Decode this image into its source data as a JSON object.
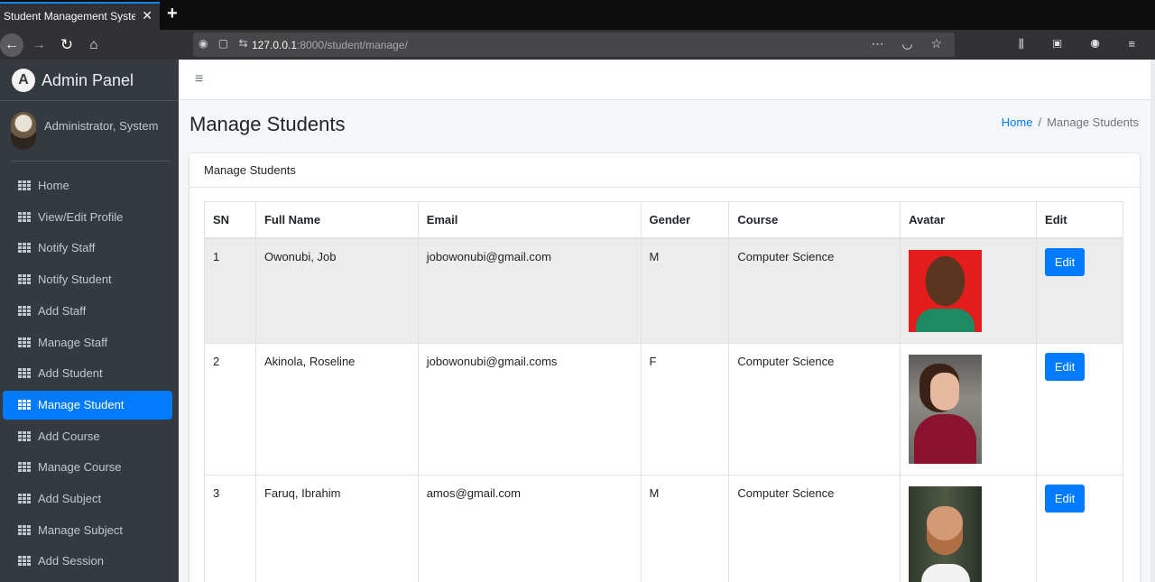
{
  "browser": {
    "tab_title": "Student Management System",
    "tab_close": "✕",
    "new_tab": "+",
    "url_host": "127.0.0.1",
    "url_path": ":8000/student/manage/",
    "nav": {
      "back": "←",
      "forward": "→",
      "reload": "↻",
      "home": "⌂"
    }
  },
  "sidebar": {
    "brand": "Admin Panel",
    "brand_logo": "A",
    "user_name": "Administrator, System",
    "items": [
      {
        "label": "Home",
        "active": false
      },
      {
        "label": "View/Edit Profile",
        "active": false
      },
      {
        "label": "Notify Staff",
        "active": false
      },
      {
        "label": "Notify Student",
        "active": false
      },
      {
        "label": "Add Staff",
        "active": false
      },
      {
        "label": "Manage Staff",
        "active": false
      },
      {
        "label": "Add Student",
        "active": false
      },
      {
        "label": "Manage Student",
        "active": true
      },
      {
        "label": "Add Course",
        "active": false
      },
      {
        "label": "Manage Course",
        "active": false
      },
      {
        "label": "Add Subject",
        "active": false
      },
      {
        "label": "Manage Subject",
        "active": false
      },
      {
        "label": "Add Session",
        "active": false
      }
    ]
  },
  "header": {
    "menu_icon": "≡"
  },
  "page": {
    "title": "Manage Students",
    "breadcrumb_home": "Home",
    "breadcrumb_sep": "/",
    "breadcrumb_current": "Manage Students"
  },
  "card": {
    "title": "Manage Students",
    "columns": [
      "SN",
      "Full Name",
      "Email",
      "Gender",
      "Course",
      "Avatar",
      "Edit"
    ],
    "rows": [
      {
        "sn": "1",
        "name": "Owonubi, Job",
        "email": "jobowonubi@gmail.com",
        "gender": "M",
        "course": "Computer Science",
        "edit": "Edit"
      },
      {
        "sn": "2",
        "name": "Akinola, Roseline",
        "email": "jobowonubi@gmail.coms",
        "gender": "F",
        "course": "Computer Science",
        "edit": "Edit"
      },
      {
        "sn": "3",
        "name": "Faruq, Ibrahim",
        "email": "amos@gmail.com",
        "gender": "M",
        "course": "Computer Science",
        "edit": "Edit"
      }
    ]
  },
  "colors": {
    "accent": "#007bff",
    "sidebar_bg": "#343a40",
    "striped_row": "#ececec"
  }
}
